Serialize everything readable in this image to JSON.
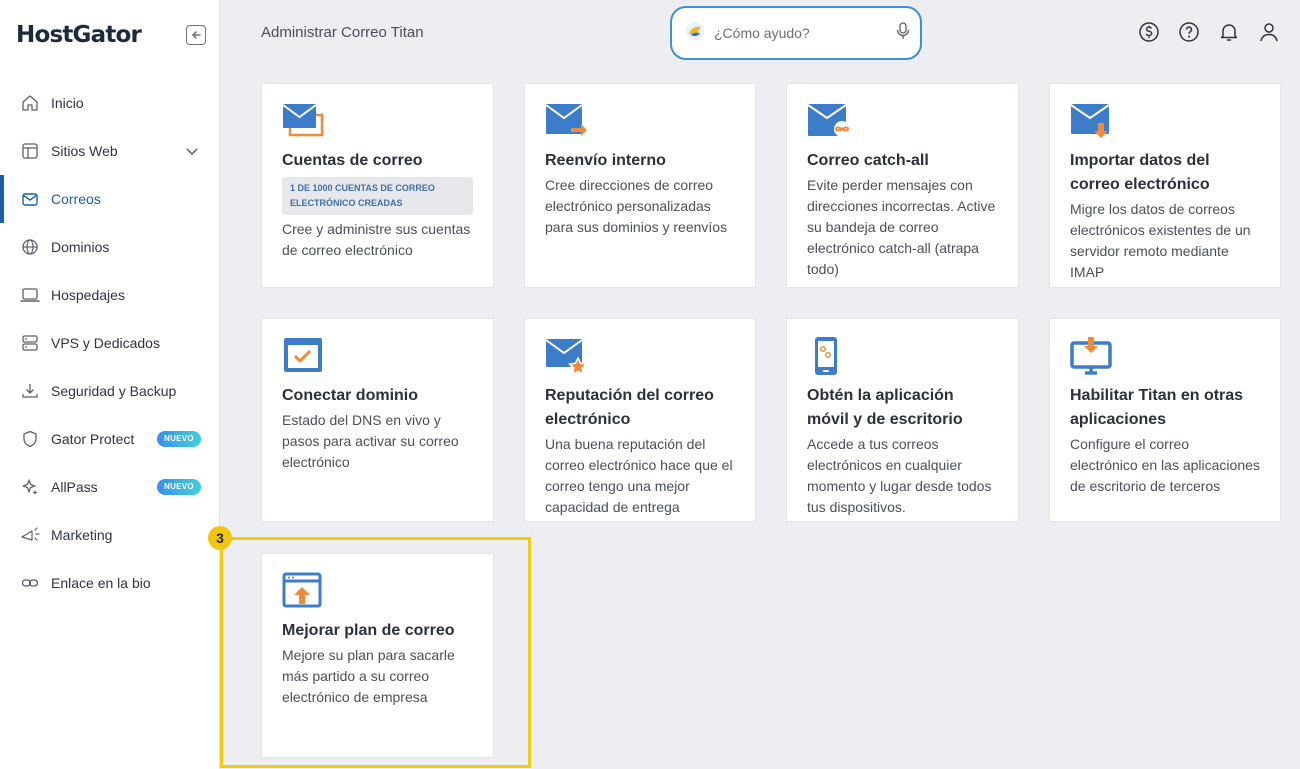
{
  "brand": {
    "logo_text": "HostGator"
  },
  "sidebar": {
    "items": [
      {
        "label": "Inicio",
        "icon": "home-icon"
      },
      {
        "label": "Sitios Web",
        "icon": "layout-icon"
      },
      {
        "label": "Correos",
        "icon": "mail-icon",
        "active": true
      },
      {
        "label": "Dominios",
        "icon": "globe-icon"
      },
      {
        "label": "Hospedajes",
        "icon": "laptop-icon"
      },
      {
        "label": "VPS y Dedicados",
        "icon": "server-icon"
      },
      {
        "label": "Seguridad y Backup",
        "icon": "download-icon"
      },
      {
        "label": "Gator Protect",
        "icon": "shield-icon",
        "badge": "NUEVO"
      },
      {
        "label": "AllPass",
        "icon": "sparkle-icon",
        "badge": "NUEVO"
      },
      {
        "label": "Marketing",
        "icon": "megaphone-icon"
      },
      {
        "label": "Enlace en la bio",
        "icon": "link-icon"
      }
    ]
  },
  "header": {
    "title": "Administrar Correo Titan",
    "search_placeholder": "¿Cómo ayudo?"
  },
  "cards": [
    {
      "title": "Cuentas de correo",
      "chip": "1 DE 1000 CUENTAS DE CORREO ELECTRÓNICO CREADAS",
      "description": "Cree y administre sus cuentas de correo electrónico"
    },
    {
      "title": "Reenvío interno",
      "description": "Cree direcciones de correo electrónico personalizadas para sus dominios y reenvíos"
    },
    {
      "title": "Correo catch-all",
      "description": "Evite perder mensajes con direcciones incorrectas. Active su bandeja de correo electrónico catch-all (atrapa todo)"
    },
    {
      "title": "Importar datos del correo electrónico",
      "description": "Migre los datos de correos electrónicos existentes de un servidor remoto mediante IMAP"
    },
    {
      "title": "Conectar dominio",
      "description": "Estado del DNS en vivo y pasos para activar su correo electrónico"
    },
    {
      "title": "Reputación del correo electrónico",
      "description": "Una buena reputación del correo electrónico hace que el correo tengo una mejor capacidad de entrega"
    },
    {
      "title": "Obtén la aplicación móvil y de escritorio",
      "description": "Accede a tus correos electrónicos en cualquier momento y lugar desde todos tus dispositivos."
    },
    {
      "title": "Habilitar Titan en otras aplicaciones",
      "description": "Configure el correo electrónico en las aplicaciones de escritorio de terceros"
    },
    {
      "title": "Mejorar plan de correo",
      "description": "Mejore su plan para sacarle más partido a su correo electrónico de empresa"
    }
  ],
  "step_marker": "3",
  "colors": {
    "accent": "#1e5fa8",
    "icon_blue": "#3d7cc9",
    "icon_orange": "#f08a3c",
    "highlight": "#f2cc12"
  }
}
